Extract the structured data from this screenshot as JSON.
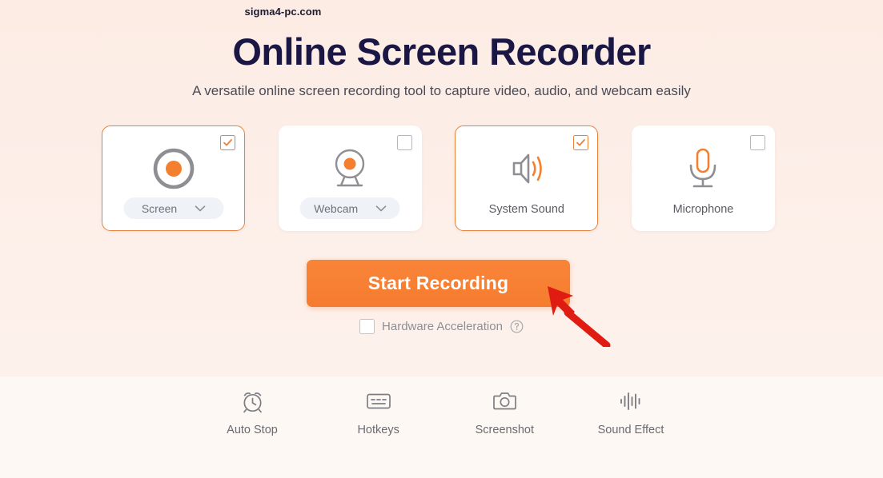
{
  "watermark": "sigma4-pc.com",
  "hero": {
    "title": "Online Screen Recorder",
    "subtitle": "A versatile online screen recording tool to capture video, audio, and webcam easily"
  },
  "colors": {
    "accent_orange": "#f57c2f",
    "checkbox_orange": "#e8823c",
    "title_navy": "#1b1744",
    "page_background": "#fceee7",
    "footer_background": "#fdf8f3",
    "icon_gray": "#8a8a8f",
    "annotation_red": "#e01b12"
  },
  "sources": [
    {
      "id": "screen",
      "label": "Screen",
      "icon": "record-circle-icon",
      "selected": true,
      "checkbox_checked": true,
      "has_dropdown": true,
      "dropdown_value": "Screen"
    },
    {
      "id": "webcam",
      "label": "Webcam",
      "icon": "webcam-icon",
      "selected": false,
      "checkbox_checked": false,
      "has_dropdown": true,
      "dropdown_value": "Webcam"
    },
    {
      "id": "system-sound",
      "label": "System Sound",
      "icon": "speaker-icon",
      "selected": true,
      "checkbox_checked": true,
      "has_dropdown": false,
      "dropdown_value": ""
    },
    {
      "id": "microphone",
      "label": "Microphone",
      "icon": "microphone-icon",
      "selected": false,
      "checkbox_checked": false,
      "has_dropdown": false,
      "dropdown_value": ""
    }
  ],
  "primary_action": {
    "label": "Start Recording"
  },
  "hardware_acceleration": {
    "label": "Hardware Acceleration",
    "checked": false,
    "help_icon": "question-mark-circle-icon"
  },
  "tools": [
    {
      "id": "auto-stop",
      "label": "Auto Stop",
      "icon": "alarm-clock-icon"
    },
    {
      "id": "hotkeys",
      "label": "Hotkeys",
      "icon": "keyboard-icon"
    },
    {
      "id": "screenshot",
      "label": "Screenshot",
      "icon": "camera-icon"
    },
    {
      "id": "sound-effect",
      "label": "Sound Effect",
      "icon": "waveform-icon"
    }
  ],
  "annotation": {
    "type": "red-arrow",
    "points_to": "Start Recording"
  }
}
